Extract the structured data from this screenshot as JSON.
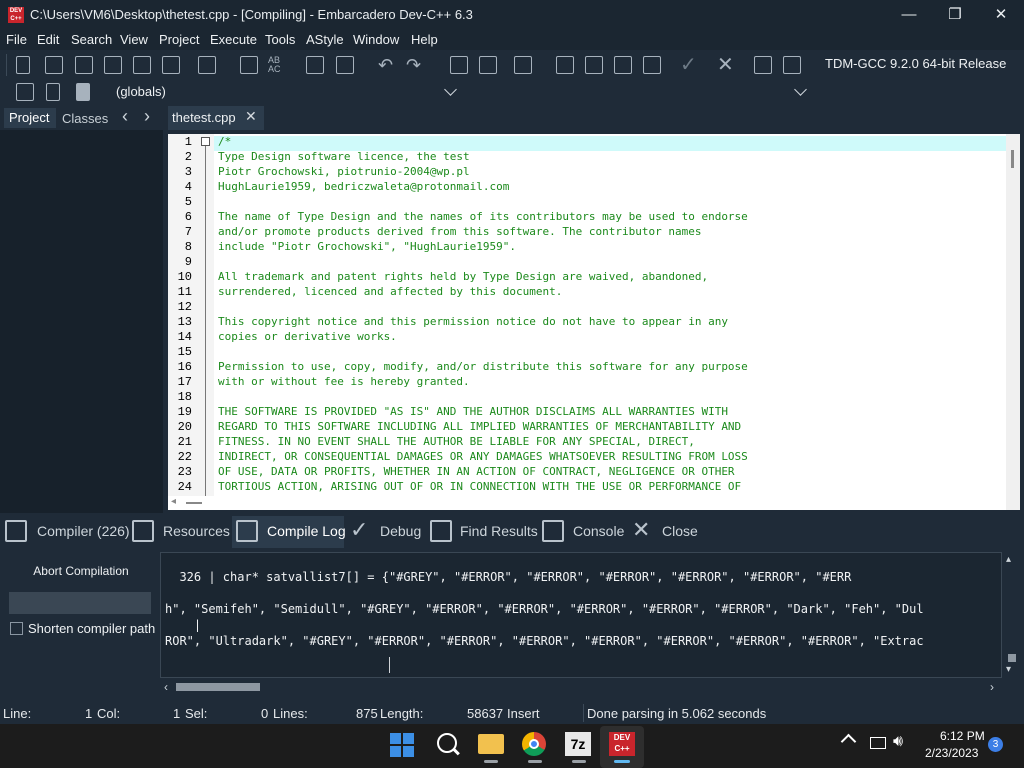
{
  "window": {
    "title": "C:\\Users\\VM6\\Desktop\\thetest.cpp - [Compiling] - Embarcadero Dev-C++ 6.3",
    "icon_text": "DEV C++",
    "minimize": "—",
    "maximize": "❐",
    "close": "✕"
  },
  "menu": [
    "File",
    "Edit",
    "Search",
    "View",
    "Project",
    "Execute",
    "Tools",
    "AStyle",
    "Window",
    "Help"
  ],
  "toolbar": {
    "compiler_set": "TDM-GCC 9.2.0 64-bit Release",
    "scope_combo": "(globals)"
  },
  "left_panel": {
    "tabs": [
      "Project",
      "Classes"
    ],
    "prev": "‹",
    "next": "›"
  },
  "editor": {
    "file_tab": "thetest.cpp",
    "file_tab_close": "✕",
    "lines": [
      {
        "n": "1",
        "text": "/*"
      },
      {
        "n": "2",
        "text": "Type Design software licence, the test"
      },
      {
        "n": "3",
        "text": "Piotr Grochowski, piotrunio-2004@wp.pl"
      },
      {
        "n": "4",
        "text": "HughLaurie1959, bedriczwaleta@protonmail.com"
      },
      {
        "n": "5",
        "text": ""
      },
      {
        "n": "6",
        "text": "The name of Type Design and the names of its contributors may be used to endorse"
      },
      {
        "n": "7",
        "text": "and/or promote products derived from this software. The contributor names"
      },
      {
        "n": "8",
        "text": "include \"Piotr Grochowski\", \"HughLaurie1959\"."
      },
      {
        "n": "9",
        "text": ""
      },
      {
        "n": "10",
        "text": "All trademark and patent rights held by Type Design are waived, abandoned,"
      },
      {
        "n": "11",
        "text": "surrendered, licenced and affected by this document."
      },
      {
        "n": "12",
        "text": ""
      },
      {
        "n": "13",
        "text": "This copyright notice and this permission notice do not have to appear in any"
      },
      {
        "n": "14",
        "text": "copies or derivative works."
      },
      {
        "n": "15",
        "text": ""
      },
      {
        "n": "16",
        "text": "Permission to use, copy, modify, and/or distribute this software for any purpose"
      },
      {
        "n": "17",
        "text": "with or without fee is hereby granted."
      },
      {
        "n": "18",
        "text": ""
      },
      {
        "n": "19",
        "text": "THE SOFTWARE IS PROVIDED \"AS IS\" AND THE AUTHOR DISCLAIMS ALL WARRANTIES WITH"
      },
      {
        "n": "20",
        "text": "REGARD TO THIS SOFTWARE INCLUDING ALL IMPLIED WARRANTIES OF MERCHANTABILITY AND"
      },
      {
        "n": "21",
        "text": "FITNESS. IN NO EVENT SHALL THE AUTHOR BE LIABLE FOR ANY SPECIAL, DIRECT,"
      },
      {
        "n": "22",
        "text": "INDIRECT, OR CONSEQUENTIAL DAMAGES OR ANY DAMAGES WHATSOEVER RESULTING FROM LOSS"
      },
      {
        "n": "23",
        "text": "OF USE, DATA OR PROFITS, WHETHER IN AN ACTION OF CONTRACT, NEGLIGENCE OR OTHER"
      },
      {
        "n": "24",
        "text": "TORTIOUS ACTION, ARISING OUT OF OR IN CONNECTION WITH THE USE OR PERFORMANCE OF"
      }
    ]
  },
  "bottom_tabs": [
    {
      "label": "Compiler (226)",
      "icon": "grid-icon"
    },
    {
      "label": "Resources",
      "icon": "resources-icon"
    },
    {
      "label": "Compile Log",
      "icon": "bar-chart-icon"
    },
    {
      "label": "Debug",
      "icon": "check-icon"
    },
    {
      "label": "Find Results",
      "icon": "search-doc-icon"
    },
    {
      "label": "Console",
      "icon": "console-icon"
    },
    {
      "label": "Close",
      "icon": "close-icon"
    }
  ],
  "compile_panel": {
    "abort_label": "Abort Compilation",
    "shorten_label": "Shorten compiler path",
    "log_lines": [
      "  326 | char* satvallist7[] = {\"#GREY\", \"#ERROR\", \"#ERROR\", \"#ERROR\", \"#ERROR\", \"#ERROR\", \"#ERR",
      "h\", \"Semifeh\", \"Semidull\", \"#GREY\", \"#ERROR\", \"#ERROR\", \"#ERROR\", \"#ERROR\", \"#ERROR\", \"Dark\", \"Feh\", \"Dul",
      "    |",
      "ROR\", \"Ultradark\", \"#GREY\", \"#ERROR\", \"#ERROR\", \"#ERROR\", \"#ERROR\", \"#ERROR\", \"#ERROR\", \"#ERROR\", \"Extrac"
    ]
  },
  "status": {
    "line_label": "Line:",
    "line_value": "1",
    "col_label": "Col:",
    "col_value": "1",
    "sel_label": "Sel:",
    "sel_value": "0",
    "lines_label": "Lines:",
    "lines_value": "875",
    "length_label": "Length:",
    "length_value": "58637",
    "mode": "Insert",
    "message": "Done parsing in 5.062 seconds"
  },
  "taskbar": {
    "time": "6:12 PM",
    "date": "2/23/2023",
    "notifications": "3",
    "apps": [
      "windows-start-icon",
      "search-icon",
      "file-explorer-icon",
      "chrome-icon",
      "7zip-icon",
      "devcpp-icon"
    ],
    "app_7z_text": "7z",
    "app_dev_text": "DEV C++"
  },
  "colors": {
    "background": "#1f2b38",
    "editor_bg": "#ffffff",
    "comment_green": "#1c8a1c",
    "highlight_line": "#cffafa"
  }
}
